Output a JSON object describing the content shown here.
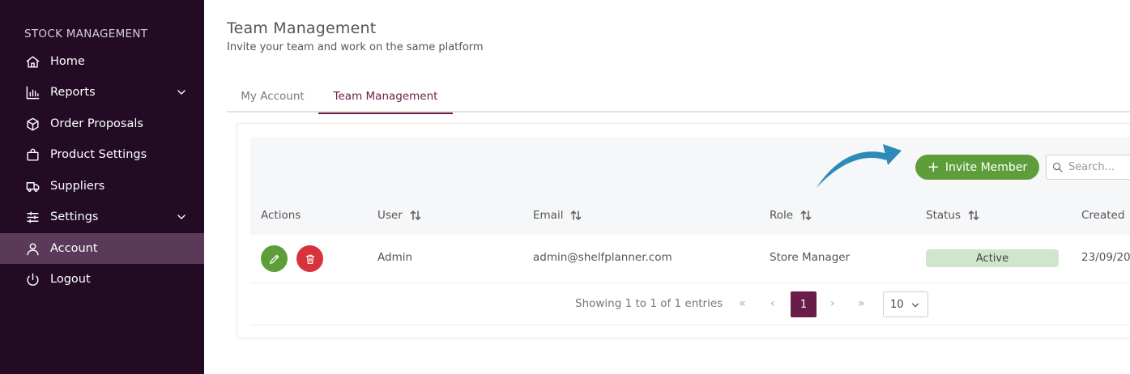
{
  "sidebar": {
    "section_title": "STOCK MANAGEMENT",
    "items": [
      {
        "label": "Home",
        "icon": "home-icon"
      },
      {
        "label": "Reports",
        "icon": "bar-chart-icon"
      },
      {
        "label": "Order Proposals",
        "icon": "box-icon"
      },
      {
        "label": "Product Settings",
        "icon": "shopping-bag-icon"
      },
      {
        "label": "Suppliers",
        "icon": "truck-icon"
      },
      {
        "label": "Settings",
        "icon": "sliders-icon"
      },
      {
        "label": "Account",
        "icon": "user-icon"
      },
      {
        "label": "Logout",
        "icon": "power-icon"
      }
    ]
  },
  "header": {
    "title": "Team Management",
    "subtitle": "Invite your team and work on the same platform"
  },
  "tabs": [
    {
      "label": "My Account"
    },
    {
      "label": "Team Management"
    }
  ],
  "toolbar": {
    "invite_label": "Invite Member",
    "search_placeholder": "Search..."
  },
  "table": {
    "columns": [
      "Actions",
      "User",
      "Email",
      "Role",
      "Status",
      "Created"
    ],
    "rows": [
      {
        "user": "Admin",
        "email": "admin@shelfplanner.com",
        "role": "Store Manager",
        "status": "Active",
        "created": "23/09/20"
      }
    ]
  },
  "pagination": {
    "info": "Showing 1 to 1 of 1 entries",
    "first": "«",
    "prev": "‹",
    "current": "1",
    "next": "›",
    "last": "»",
    "page_size": "10"
  },
  "colors": {
    "sidebar_bg": "#220b23",
    "active_item": "#5a3a58",
    "accent": "#6b1d4a",
    "invite_button": "#5e9e3a",
    "delete_button": "#d8323a",
    "status_active": "#cfe6cc",
    "annotation_arrow": "#2e8bb8"
  }
}
